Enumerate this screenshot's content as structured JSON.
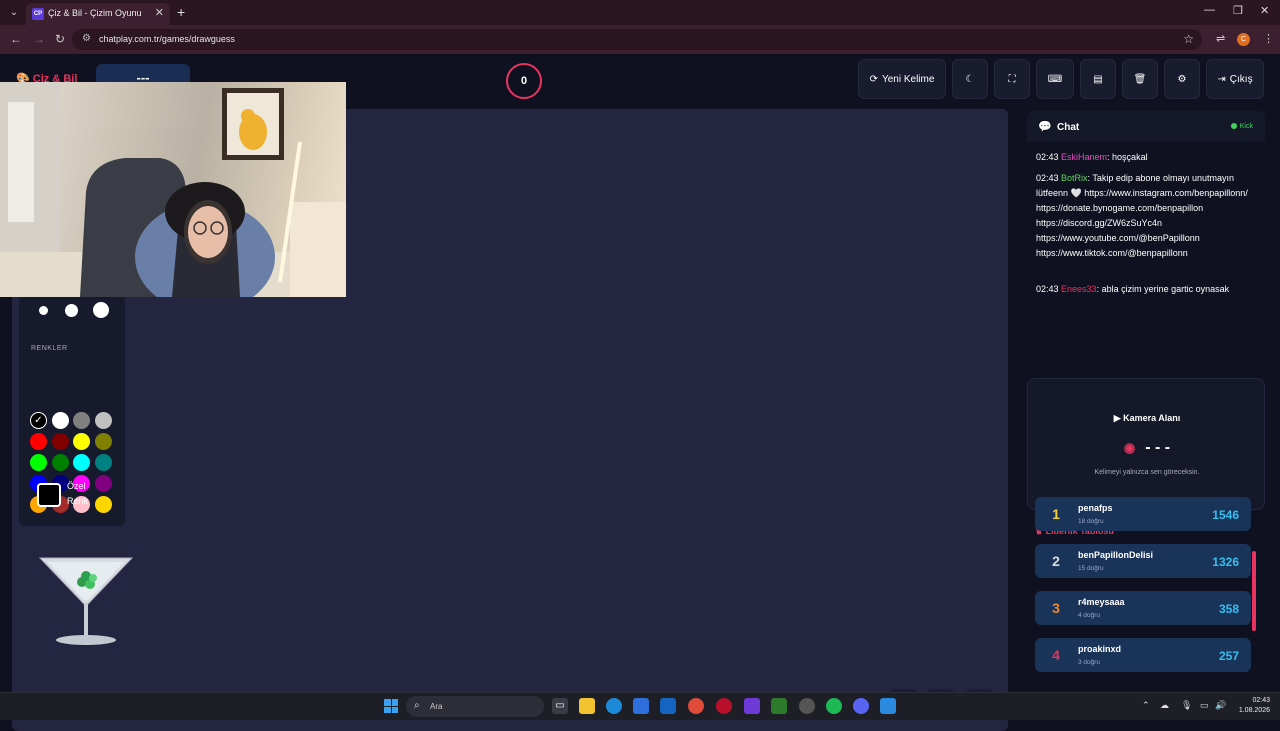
{
  "browser": {
    "tab_title": "Çiz & Bil - Çizim Oyunu",
    "tab_favicon": "CP",
    "url": "chatplay.com.tr/games/drawguess",
    "profile_initial": "C"
  },
  "app": {
    "logo": "Çiz & Bil",
    "word_display": "---",
    "timer": "0",
    "header_buttons": {
      "new_word": "Yeni Kelime",
      "logout": "Çıkış"
    }
  },
  "tools": {
    "colors_label": "RENKLER",
    "custom_color_label": "Özel Renk",
    "colors": [
      "#000000",
      "#ffffff",
      "#808080",
      "#c0c0c0",
      "#ff0000",
      "#800000",
      "#ffff00",
      "#808000",
      "#00ff00",
      "#008000",
      "#00ffff",
      "#008080",
      "#0000ff",
      "#000080",
      "#ff00ff",
      "#800080",
      "#ffa500",
      "#a52a2a",
      "#ffc0cb",
      "#ffd700"
    ]
  },
  "chat": {
    "title": "Chat",
    "platform": "Kick",
    "messages": [
      {
        "time": "02:43",
        "user": "EskiHanem",
        "user_color": "#e14fbf",
        "text": "hoşçakal"
      },
      {
        "time": "02:43",
        "user": "BotRix",
        "user_color": "#5fd35f",
        "text": "Takip edip abone olmayı unutmayın lütfeenn 🤍 https://www.instagram.com/benpapillonn/ https://donate.bynogame.com/benpapillon https://discord.gg/ZW6zSuYc4n https://www.youtube.com/@benPapillonn https://www.tiktok.com/@benpapillonn"
      },
      {
        "time": "02:43",
        "user": "Enees33",
        "user_color": "#e8345e",
        "text": "abla çizim yerine gartic oynasak"
      }
    ]
  },
  "camera": {
    "title": "Kamera Alanı",
    "word": "- - -",
    "note": "Kelimeyi yalnızca sen göreceksin."
  },
  "leaderboard": {
    "title": "Liderlik Tablosu",
    "entries": [
      {
        "rank": "1",
        "name": "penafps",
        "sub": "18 doğru",
        "score": "1546",
        "rank_color": "#f5d33a"
      },
      {
        "rank": "2",
        "name": "benPapillonDelisi",
        "sub": "15 doğru",
        "score": "1326",
        "rank_color": "#d8dce6"
      },
      {
        "rank": "3",
        "name": "r4meysaaa",
        "sub": "4 doğru",
        "score": "358",
        "rank_color": "#e58b3a"
      },
      {
        "rank": "4",
        "name": "proakinxd",
        "sub": "3 doğru",
        "score": "257",
        "rank_color": "#e8345e"
      }
    ]
  },
  "taskbar": {
    "search_placeholder": "Ara",
    "time": "02:43",
    "date": "1.08.2026"
  }
}
